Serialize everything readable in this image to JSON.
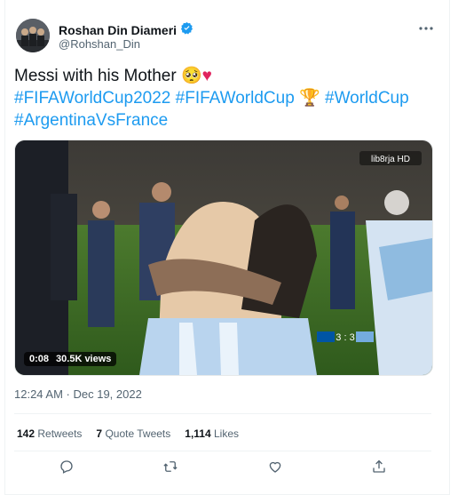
{
  "author": {
    "display_name": "Roshan Din Diameri",
    "handle": "@Rohshan_Din",
    "verified": true
  },
  "tweet": {
    "line1_text": "Messi with his Mother ",
    "line1_emoji_face": "🥺",
    "line1_emoji_heart": "♥",
    "hashtag1": "#FIFAWorldCup2022",
    "hashtag2": "#FIFAWorldCup",
    "hashtag2_emoji": "🏆",
    "hashtag3": "#WorldCup",
    "hashtag4": "#ArgentinaVsFrance"
  },
  "media": {
    "type": "video",
    "duration": "0:08",
    "views": "30.5K views",
    "scoreboard": "3 : 3",
    "broadcaster_logo": "lib8rja HD"
  },
  "timestamp": "12:24 AM · Dec 19, 2022",
  "stats": {
    "retweets_count": "142",
    "retweets_label": "Retweets",
    "quote_count": "7",
    "quote_label": "Quote Tweets",
    "likes_count": "1,114",
    "likes_label": "Likes"
  },
  "colors": {
    "link": "#1d9bf0",
    "secondary_text": "#536471",
    "primary_text": "#0f1419",
    "heart_emoji": "#e0245e"
  },
  "icons": [
    "more-icon",
    "verified-icon",
    "reply-icon",
    "retweet-icon",
    "like-icon",
    "share-icon"
  ]
}
